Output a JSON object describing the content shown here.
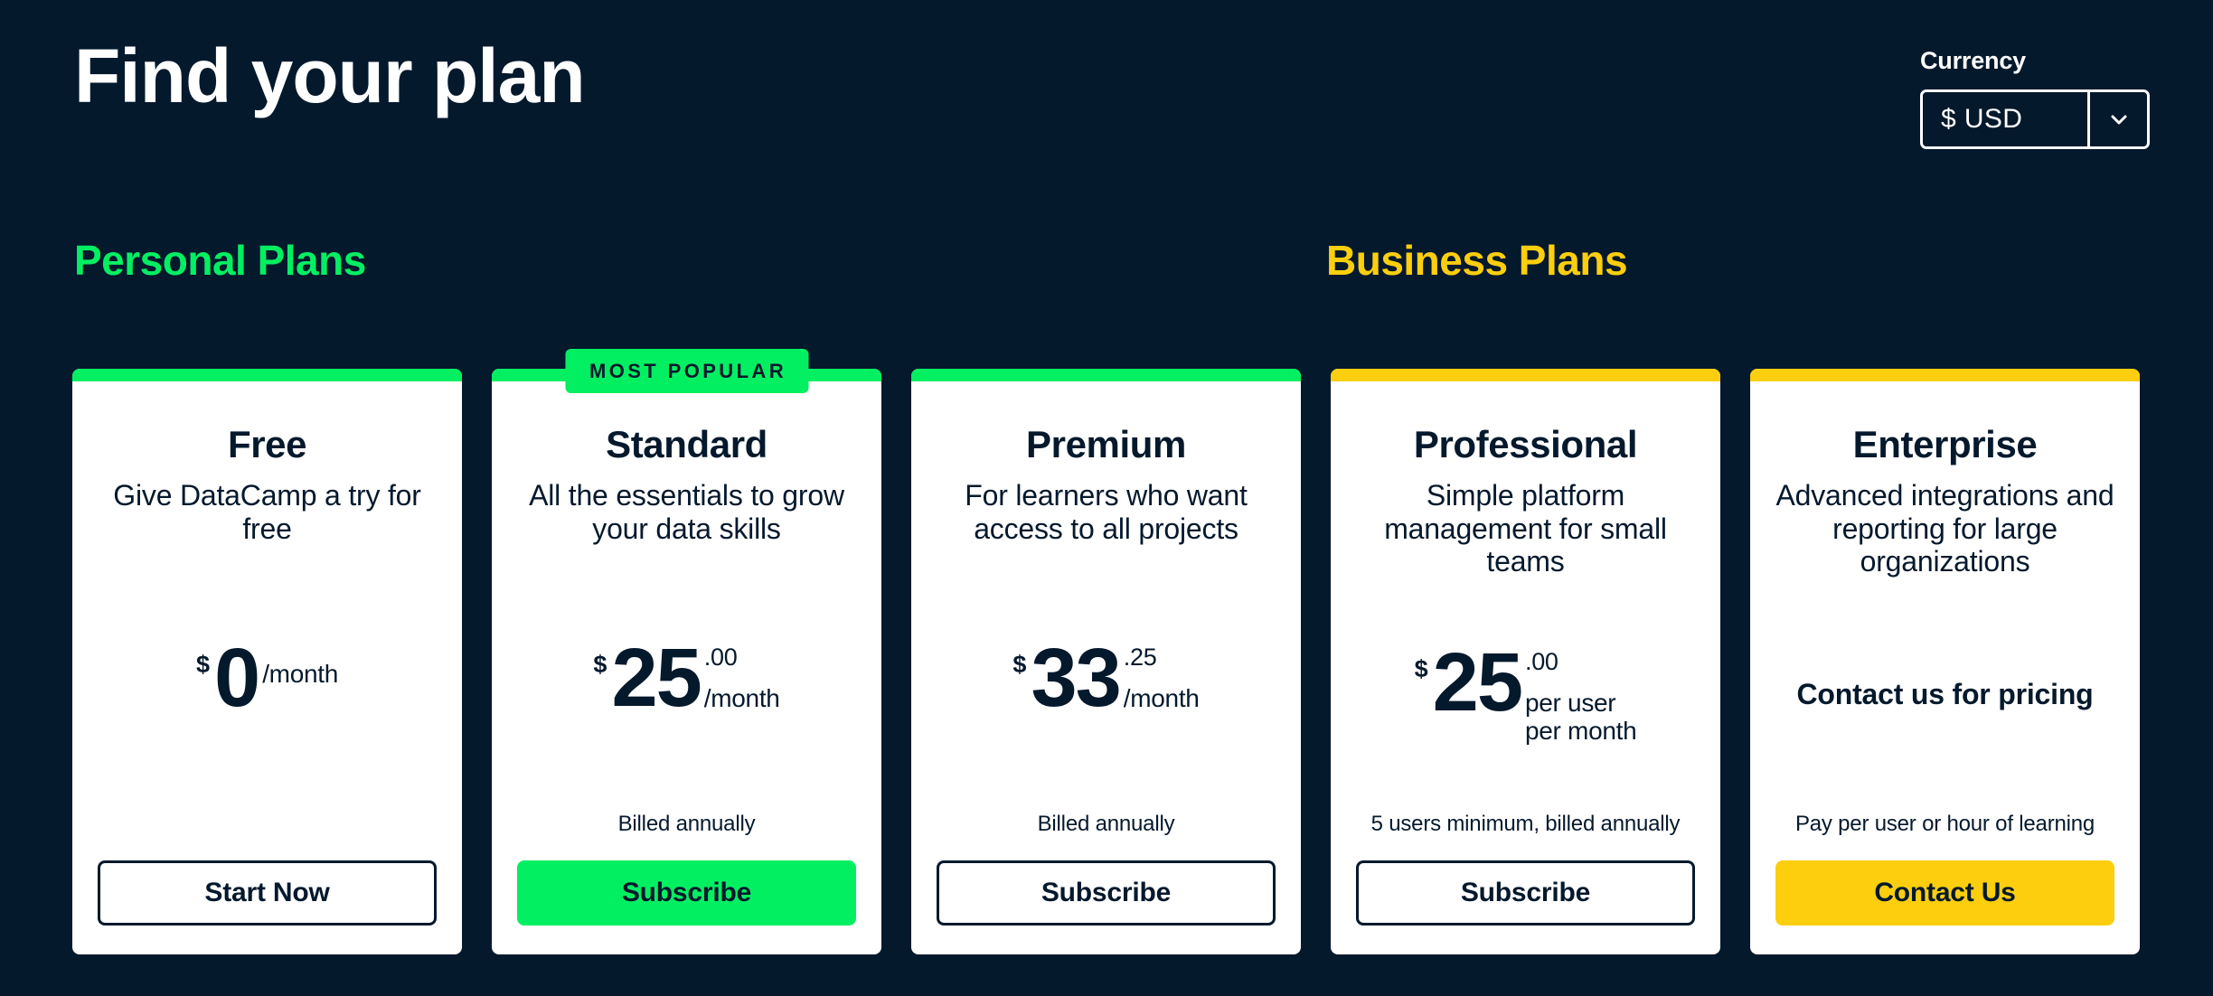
{
  "header": {
    "title": "Find your plan",
    "currency": {
      "label": "Currency",
      "selected": "$ USD",
      "chevron_icon": "chevron-down-icon"
    }
  },
  "sections": [
    {
      "id": "personal",
      "label": "Personal Plans",
      "color": "#03EF62"
    },
    {
      "id": "business",
      "label": "Business Plans",
      "color": "#FCCE0D"
    }
  ],
  "plans": [
    {
      "id": "free",
      "group": "personal",
      "accent": "#03EF62",
      "badge": "",
      "title": "Free",
      "description": "Give DataCamp a try for free",
      "price_currency": "$",
      "price_amount": "0",
      "price_cents": "",
      "price_period": "/month",
      "price_contact": "",
      "billing_note": "",
      "cta_label": "Start Now",
      "cta_style": "outline"
    },
    {
      "id": "standard",
      "group": "personal",
      "accent": "#03EF62",
      "badge": "MOST POPULAR",
      "title": "Standard",
      "description": "All the essentials to grow your data skills",
      "price_currency": "$",
      "price_amount": "25",
      "price_cents": ".00",
      "price_period": "/month",
      "price_contact": "",
      "billing_note": "Billed annually",
      "cta_label": "Subscribe",
      "cta_style": "filled-green"
    },
    {
      "id": "premium",
      "group": "personal",
      "accent": "#03EF62",
      "badge": "",
      "title": "Premium",
      "description": "For learners who want access to all projects",
      "price_currency": "$",
      "price_amount": "33",
      "price_cents": ".25",
      "price_period": "/month",
      "price_contact": "",
      "billing_note": "Billed annually",
      "cta_label": "Subscribe",
      "cta_style": "outline"
    },
    {
      "id": "professional",
      "group": "business",
      "accent": "#FCCE0D",
      "badge": "",
      "title": "Professional",
      "description": "Simple platform management for small teams",
      "price_currency": "$",
      "price_amount": "25",
      "price_cents": ".00",
      "price_period": "per user\nper month",
      "price_contact": "",
      "billing_note": "5 users minimum, billed annually",
      "cta_label": "Subscribe",
      "cta_style": "outline"
    },
    {
      "id": "enterprise",
      "group": "business",
      "accent": "#FCCE0D",
      "badge": "",
      "title": "Enterprise",
      "description": "Advanced integrations and reporting for large organizations",
      "price_currency": "",
      "price_amount": "",
      "price_cents": "",
      "price_period": "",
      "price_contact": "Contact us for pricing",
      "billing_note": "Pay per user or hour of learning",
      "cta_label": "Contact Us",
      "cta_style": "filled-yellow"
    }
  ],
  "colors": {
    "background": "#05192D",
    "card": "#FFFFFF",
    "text_dark": "#05192D",
    "green": "#03EF62",
    "yellow": "#FCCE0D"
  }
}
